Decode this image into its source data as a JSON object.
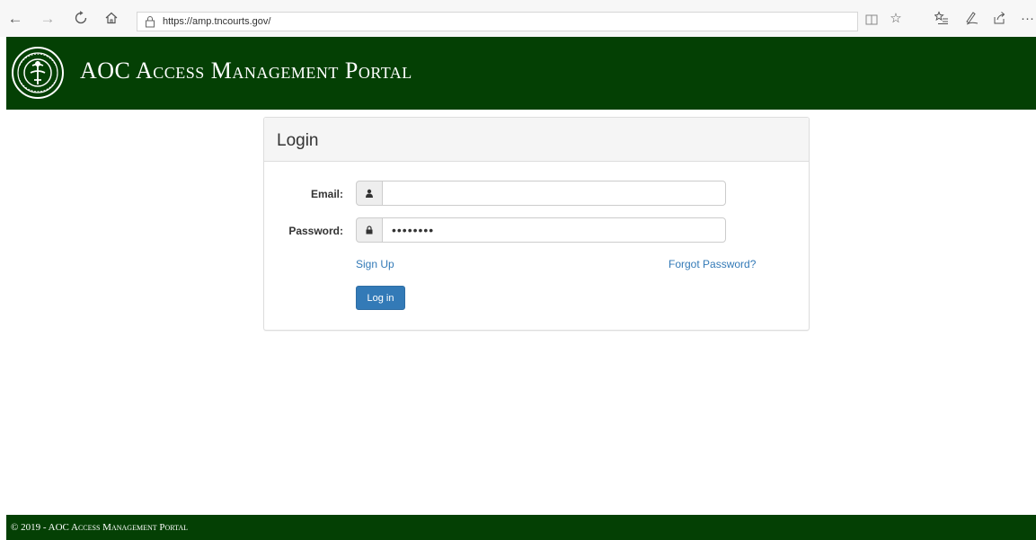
{
  "browser": {
    "url": "https://amp.tncourts.gov/"
  },
  "header": {
    "title": "AOC Access Management Portal"
  },
  "login": {
    "title": "Login",
    "email_label": "Email:",
    "email_value": "",
    "password_label": "Password:",
    "password_value": "••••••••",
    "signup_label": "Sign Up",
    "forgot_label": "Forgot Password?",
    "login_button": "Log in"
  },
  "footer": {
    "text": "© 2019 - AOC Access Management Portal"
  },
  "colors": {
    "brand_green": "#044004",
    "link_blue": "#337ab7"
  }
}
